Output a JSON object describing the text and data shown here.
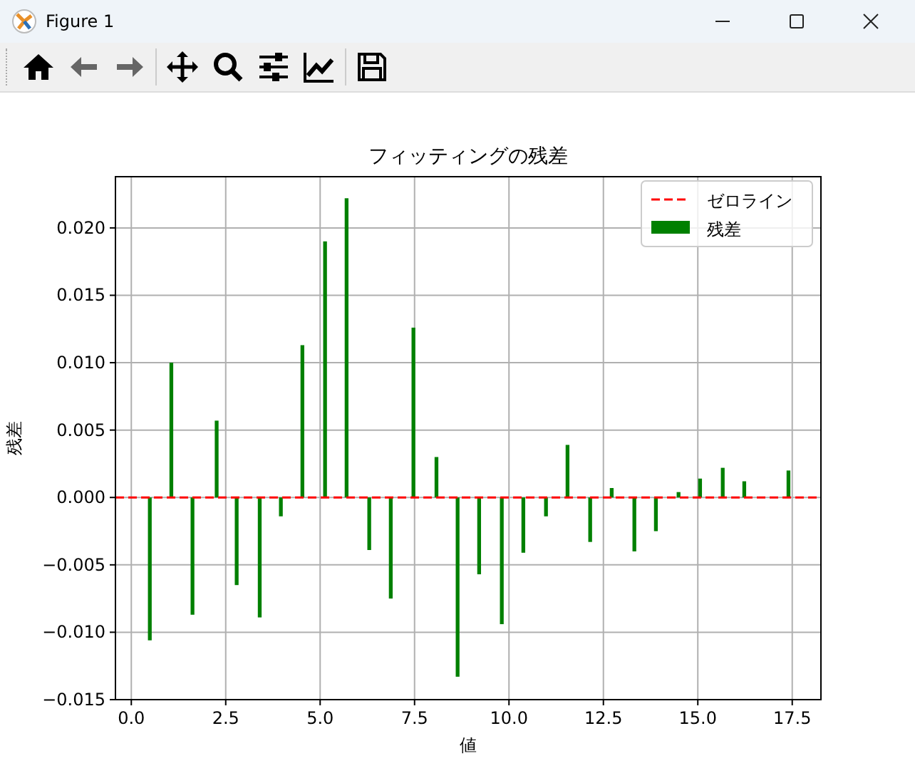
{
  "window": {
    "title": "Figure 1"
  },
  "toolbar": [
    {
      "kind": "home",
      "disabled": false
    },
    {
      "kind": "back",
      "disabled": true
    },
    {
      "kind": "forward",
      "disabled": true
    },
    {
      "kind": "separator"
    },
    {
      "kind": "move",
      "disabled": false
    },
    {
      "kind": "zoom",
      "disabled": false
    },
    {
      "kind": "sliders",
      "disabled": false
    },
    {
      "kind": "chart",
      "disabled": false
    },
    {
      "kind": "separator"
    },
    {
      "kind": "save",
      "disabled": false
    }
  ],
  "figure": {
    "chart_data": {
      "type": "bar",
      "title": "フィッティングの残差",
      "xlabel": "値",
      "ylabel": "残差",
      "x": [
        0.49,
        1.06,
        1.62,
        2.26,
        2.79,
        3.4,
        3.96,
        4.53,
        5.13,
        5.7,
        6.3,
        6.87,
        7.47,
        8.08,
        8.64,
        9.21,
        9.81,
        10.38,
        10.98,
        11.55,
        12.15,
        12.72,
        13.32,
        13.89,
        14.49,
        15.06,
        15.66,
        16.23,
        17.4
      ],
      "series": [
        {
          "name": "残差",
          "color": "#008000",
          "values": [
            -0.0106,
            0.01,
            -0.0087,
            0.0057,
            -0.0065,
            -0.0089,
            -0.0014,
            0.0113,
            0.019,
            0.0222,
            -0.0039,
            -0.0075,
            0.0126,
            0.003,
            -0.0133,
            -0.0057,
            -0.0094,
            -0.0041,
            -0.0014,
            0.0039,
            -0.0033,
            0.0007,
            -0.004,
            -0.0025,
            0.0004,
            0.0014,
            0.0022,
            0.0012,
            0.002
          ]
        }
      ],
      "xlim": [
        -0.42,
        18.26
      ],
      "ylim": [
        -0.015,
        0.0238
      ],
      "xticks": [
        {
          "value": 0,
          "label": "0.0"
        },
        {
          "value": 2.5,
          "label": "2.5"
        },
        {
          "value": 5,
          "label": "5.0"
        },
        {
          "value": 7.5,
          "label": "7.5"
        },
        {
          "value": 10,
          "label": "10.0"
        },
        {
          "value": 12.5,
          "label": "12.5"
        },
        {
          "value": 15,
          "label": "15.0"
        },
        {
          "value": 17.5,
          "label": "17.5"
        }
      ],
      "yticks": [
        {
          "value": -0.015,
          "label": "−0.015"
        },
        {
          "value": -0.01,
          "label": "−0.010"
        },
        {
          "value": -0.005,
          "label": "−0.005"
        },
        {
          "value": 0,
          "label": "0.000"
        },
        {
          "value": 0.005,
          "label": "0.005"
        },
        {
          "value": 0.01,
          "label": "0.010"
        },
        {
          "value": 0.015,
          "label": "0.015"
        },
        {
          "value": 0.02,
          "label": "0.020"
        }
      ],
      "grid": true,
      "legend": "upper right",
      "ref_lines": [
        {
          "axis": "y",
          "value": 0,
          "label": "ゼロライン",
          "color": "#ff0000"
        }
      ]
    }
  }
}
